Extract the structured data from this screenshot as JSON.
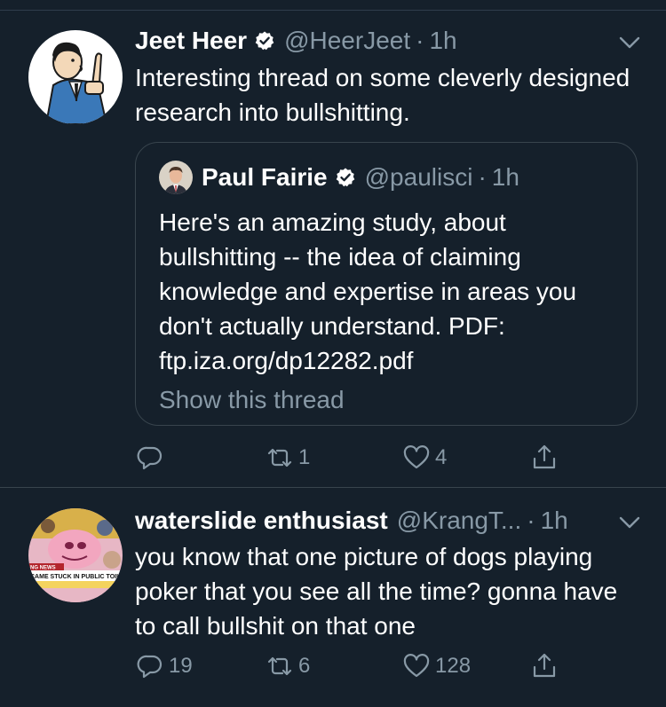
{
  "tweets": [
    {
      "name": "Jeet Heer",
      "verified": true,
      "handle": "@HeerJeet",
      "dot": "·",
      "time": "1h",
      "text": "Interesting thread on some cleverly designed research into bullshitting.",
      "avatar_icon": "cartoon-man-avatar",
      "quote": {
        "name": "Paul Fairie",
        "handle": "@paulisci",
        "dot": "·",
        "time": "1h",
        "text": "Here's an amazing study, about bullshitting -- the idea of claiming knowledge and expertise in areas you don't actually understand. PDF: ftp.iza.org/dp12282.pdf",
        "show_thread": "Show this thread"
      },
      "actions": {
        "reply": "",
        "retweet": "1",
        "like": "4"
      }
    },
    {
      "name": "waterslide enthusiast",
      "verified": false,
      "handle": "@KrangT...",
      "dot": "·",
      "time": "1h",
      "text": "you know that one picture of dogs playing poker that you see all the time? gonna have to call bullshit on that one",
      "avatar_icon": "krang-news-avatar",
      "avatar_caption_1": "NG NEWS",
      "avatar_caption_2": "CAME STUCK IN PUBLIC TOIL",
      "actions": {
        "reply": "19",
        "retweet": "6",
        "like": "128"
      }
    }
  ],
  "colors": {
    "background": "#15202b",
    "text": "#ffffff",
    "muted": "#8899a6",
    "border": "#38444d",
    "verified": "#ffffff"
  }
}
